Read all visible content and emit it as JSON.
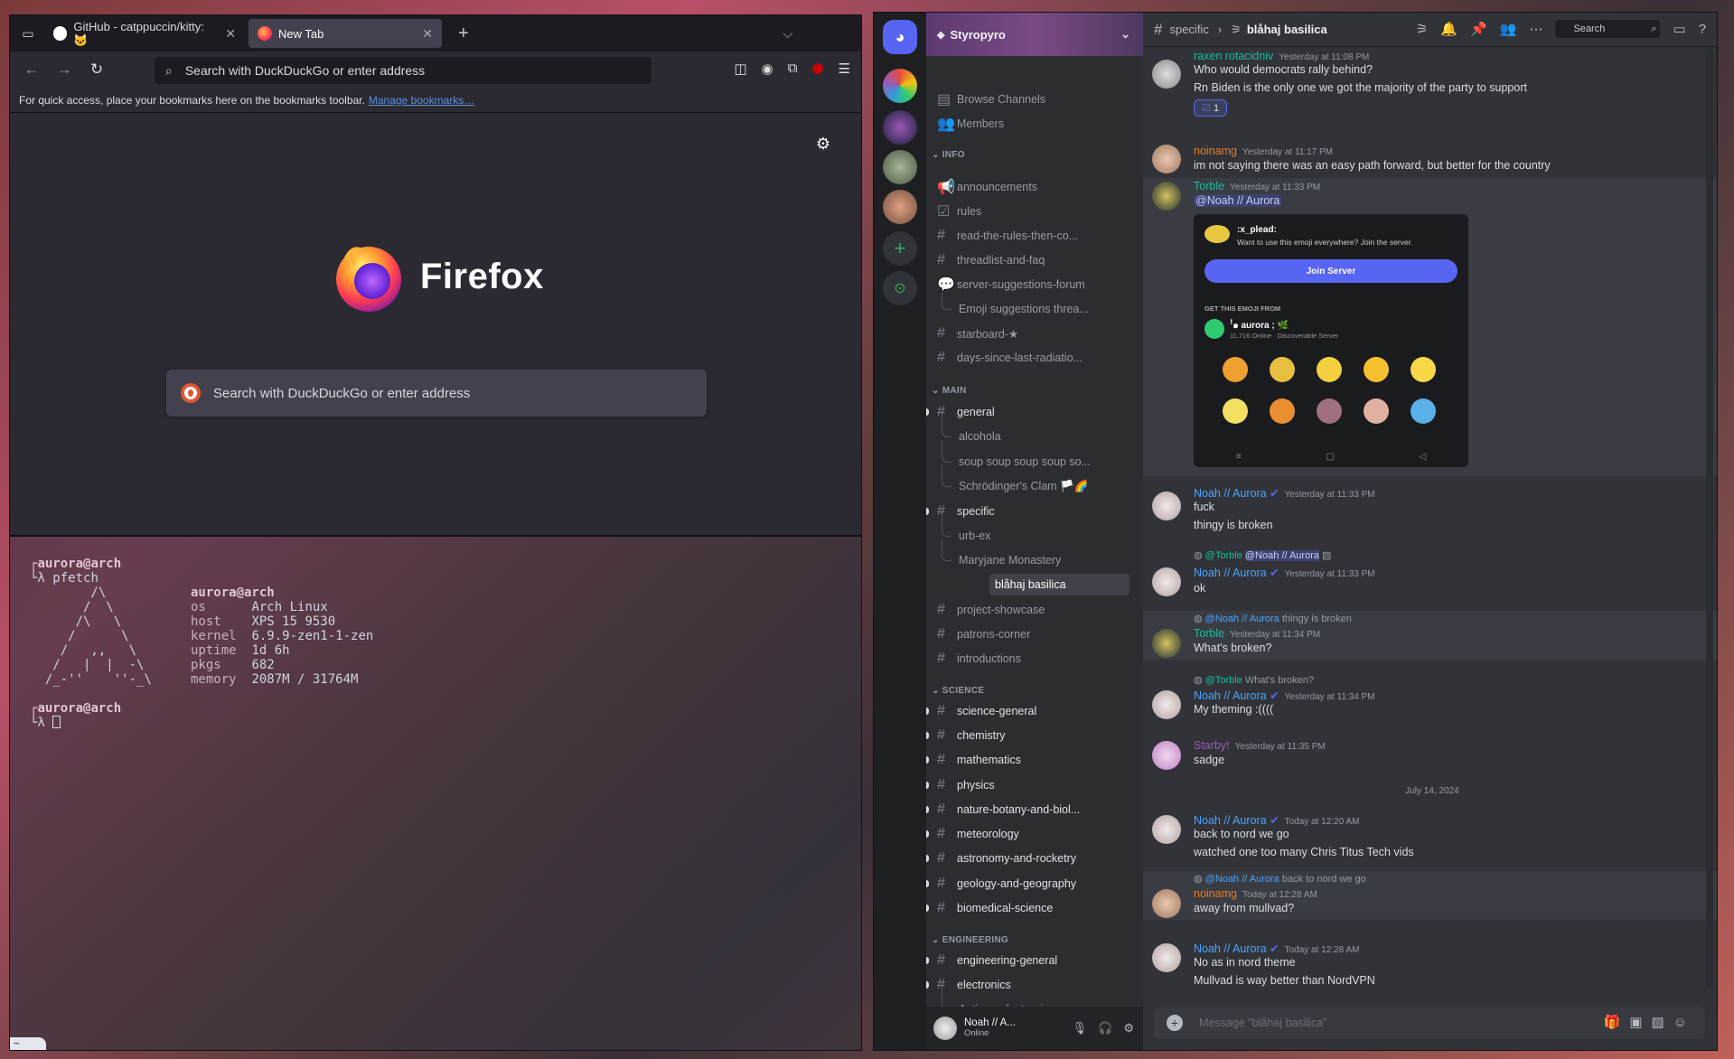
{
  "firefox": {
    "tabs": [
      {
        "label": "GitHub - catppuccin/kitty: 🐱"
      },
      {
        "label": "New Tab"
      }
    ],
    "tab_close": "✕",
    "new_tab": "+",
    "list_all_tabs": "⌵",
    "urlbar_placeholder": "Search with DuckDuckGo or enter address",
    "bookmarks_text": "For quick access, place your bookmarks here on the bookmarks toolbar.",
    "bookmarks_link": "Manage bookmarks…",
    "brand": "Firefox",
    "search_placeholder": "Search with DuckDuckGo or enter address"
  },
  "terminal": {
    "prompt_user": "aurora@arch",
    "command": "pfetch",
    "info_user": "aurora@arch",
    "info": [
      {
        "k": "os",
        "v": "Arch Linux"
      },
      {
        "k": "host",
        "v": "XPS 15 9530"
      },
      {
        "k": "kernel",
        "v": "6.9.9-zen1-1-zen"
      },
      {
        "k": "uptime",
        "v": "1d 6h"
      },
      {
        "k": "pkgs",
        "v": "682"
      },
      {
        "k": "memory",
        "v": "2087M / 31764M"
      }
    ],
    "prompt2_user": "aurora@arch",
    "tab_label": "~"
  },
  "discord": {
    "server_name": "Styropyro",
    "nav": {
      "browse": "Browse Channels",
      "members": "Members"
    },
    "categories": {
      "info": "INFO",
      "main": "MAIN",
      "science": "SCIENCE",
      "engineering": "ENGINEERING"
    },
    "channels": {
      "announcements": "announcements",
      "rules": "rules",
      "read_rules": "read-the-rules-then-co...",
      "threadlist": "threadlist-and-faq",
      "server_suggestions": "server-suggestions-forum",
      "emoji_suggestions": "Emoji suggestions threa...",
      "starboard": "starboard-★",
      "days_since": "days-since-last-radiatio...",
      "general": "general",
      "alcohola": "alcohola",
      "soup": "soup soup soup soup so...",
      "schrodinger": "Schrödinger's Clam 🏳️🌈",
      "specific": "specific",
      "urbex": "urb-ex",
      "maryjane": "Maryjane Monastery",
      "blahaj": "blåhaj basilica",
      "project": "project-showcase",
      "patrons": "patrons-corner",
      "intro": "introductions",
      "science_general": "science-general",
      "chemistry": "chemistry",
      "mathematics": "mathematics",
      "physics": "physics",
      "nature": "nature-botany-and-biol...",
      "meteorology": "meteorology",
      "astronomy": "astronomy-and-rocketry",
      "geology": "geology-and-geography",
      "biomedical": "biomedical-science",
      "engineering_general": "engineering-general",
      "electronics": "electronics",
      "antique": "Antique electronics"
    },
    "user": {
      "name": "Noah // A...",
      "status": "Online"
    },
    "topbar": {
      "parent": "specific",
      "thread": "blåhaj basilica",
      "search": "Search"
    },
    "messages": {
      "m1": {
        "name": "raxen rotacidniv",
        "time": "Yesterday at 11:08 PM",
        "line1": "Who would democrats rally behind?",
        "line2": "Rn Biden is the only one we got the majority of the party to support",
        "reaction": "1"
      },
      "m2": {
        "name": "noinamg",
        "time": "Yesterday at 11:17 PM",
        "line1": "im not saying there was an easy path forward, but better for the country"
      },
      "m3": {
        "name": "Torble",
        "time": "Yesterday at 11:33 PM",
        "mention": "@Noah // Aurora"
      },
      "embed": {
        "emoji_name": ":x_plead:",
        "desc": "Want to use this emoji everywhere? Join the server.",
        "join": "Join Server",
        "from": "GET THIS EMOJI FROM",
        "server": "ꜝ๑ aurora ; 🌿",
        "server_meta": "11,716 Online · Discoverable Server"
      },
      "m4": {
        "name": "Noah // Aurora",
        "time": "Yesterday at 11:33 PM",
        "line1": "fuck",
        "line2": "thingy is broken"
      },
      "m5": {
        "reply_to": "@Torble",
        "reply_mention": "@Noah // Aurora",
        "name": "Noah // Aurora",
        "time": "Yesterday at 11:33 PM",
        "line1": "ok"
      },
      "m6": {
        "reply_to": "@Noah // Aurora",
        "reply_text": "thingy is broken",
        "name": "Torble",
        "time": "Yesterday at 11:34 PM",
        "line1": "What's broken?"
      },
      "m7": {
        "reply_to": "@Torble",
        "reply_text": "What's broken?",
        "name": "Noah // Aurora",
        "time": "Yesterday at 11:34 PM",
        "line1": "My theming :(((("
      },
      "m8": {
        "name": "Starby!",
        "time": "Yesterday at 11:35 PM",
        "line1": "sadge"
      },
      "divider": "July 14, 2024",
      "m9": {
        "name": "Noah // Aurora",
        "time": "Today at 12:20 AM",
        "line1": "back to nord we go",
        "line2": "watched one too many Chris Titus Tech vids"
      },
      "m10": {
        "reply_to": "@Noah // Aurora",
        "reply_text": "back to nord we go",
        "name": "noinamg",
        "time": "Today at 12:28 AM",
        "line1": "away from mullvad?"
      },
      "m11": {
        "name": "Noah // Aurora",
        "time": "Today at 12:28 AM",
        "line1": "No as in nord theme",
        "line2": "Mullvad is way better than NordVPN"
      }
    },
    "input_placeholder": "Message \"blåhaj basilica\""
  },
  "colors": {
    "ff_bg": "#2b2a33",
    "discord_bg": "#313338",
    "blurple": "#5865f2",
    "name_cyan": "#1abc9c",
    "name_blue": "#4aa4ff",
    "name_orange": "#e67e22",
    "name_purple": "#9b59b6"
  }
}
